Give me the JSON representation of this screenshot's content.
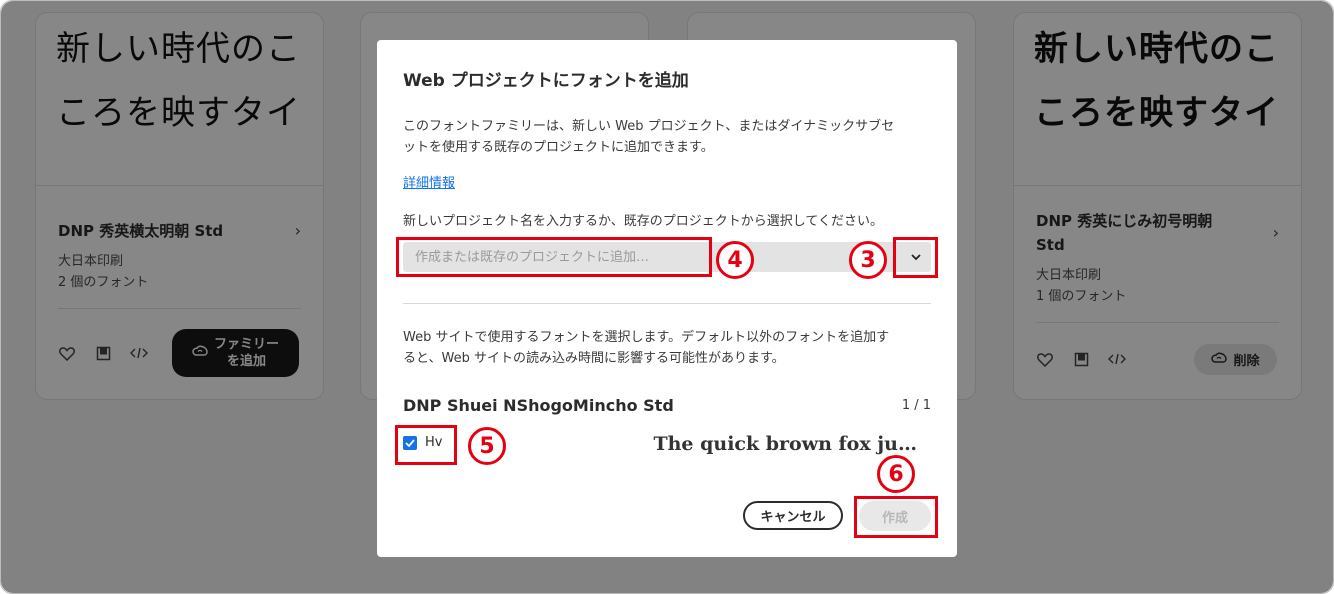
{
  "cards": [
    {
      "sample_line1": "新しい時代のこ",
      "sample_line2": "ころを映すタイ",
      "name": "DNP 秀英横太明朝 Std",
      "foundry": "大日本印刷",
      "count": "2 個のフォント",
      "action_line1": "ファミリー",
      "action_line2": "を追加"
    },
    {
      "sample_line1": "新しい時代のこ",
      "sample_line2": "ころを映すタイ",
      "name_line1": "DNP 秀英にじみ初号明朝",
      "name_line2": "Std",
      "foundry": "大日本印刷",
      "count": "1 個のフォント",
      "action": "削除"
    }
  ],
  "dialog": {
    "title": "Web プロジェクトにフォントを追加",
    "description_line1": "このフォントファミリーは、新しい Web プロジェクト、またはダイナミックサブセ",
    "description_line2": "ットを使用する既存のプロジェクトに追加できます。",
    "link": "詳細情報",
    "prompt": "新しいプロジェクト名を入力するか、既存のプロジェクトから選択してください。",
    "project_input": {
      "value": "",
      "placeholder": "作成または既存のプロジェクトに追加…"
    },
    "description2_line1": "Web サイトで使用するフォントを選択します。デフォルト以外のフォントを追加す",
    "description2_line2": "ると、Web サイトの読み込み時間に影響する可能性があります。",
    "family_name": "DNP Shuei NShogoMincho Std",
    "family_count": "1 / 1",
    "style": {
      "label": "Hv",
      "checked": true,
      "preview": "The quick brown fox ju…"
    },
    "cancel_label": "キャンセル",
    "create_label": "作成"
  },
  "annotations": {
    "n3": "3",
    "n4": "4",
    "n5": "5",
    "n6": "6",
    "color": "#e60012"
  },
  "icons": [
    "heart-icon",
    "bookmark-icon",
    "code-icon",
    "creative-cloud-icon",
    "chevron-right-icon",
    "chevron-down-icon",
    "checkbox-check-icon"
  ]
}
